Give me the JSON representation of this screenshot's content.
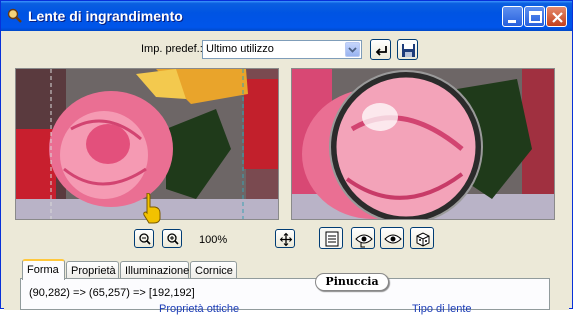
{
  "window": {
    "title": "Lente di ingrandimento"
  },
  "preset": {
    "label": "Imp. predef.:",
    "value": "Ultimo utilizzo"
  },
  "zoom": {
    "level": "100%"
  },
  "tabs": [
    {
      "label": "Forma",
      "active": true
    },
    {
      "label": "Proprietà",
      "active": false
    },
    {
      "label": "Illuminazione",
      "active": false
    },
    {
      "label": "Cornice",
      "active": false
    }
  ],
  "shape_tab": {
    "coords": "(90,282) => (65,257) => [192,192]",
    "left_heading": "Proprietà ottiche",
    "right_heading": "Tipo di lente"
  },
  "watermark": "Pinuccia",
  "icons": {
    "app": "magnifier-app-icon",
    "minimize": "minimize-icon",
    "maximize": "maximize-icon",
    "close": "close-icon",
    "reset": "reset-icon",
    "save": "save-icon",
    "zoom_out": "zoom-out-icon",
    "zoom_in": "zoom-in-icon",
    "pan": "pan-icon",
    "hand_cursor": "hand-cursor-icon",
    "proof": "proof-toggle-icon",
    "eye1": "preview-eye-icon",
    "eye2": "preview-eye-alt-icon",
    "random": "randomize-icon"
  },
  "colors": {
    "titlebar": "#0054e3",
    "close_button": "#c3401d",
    "active_tab_accent": "#ffc83c"
  }
}
